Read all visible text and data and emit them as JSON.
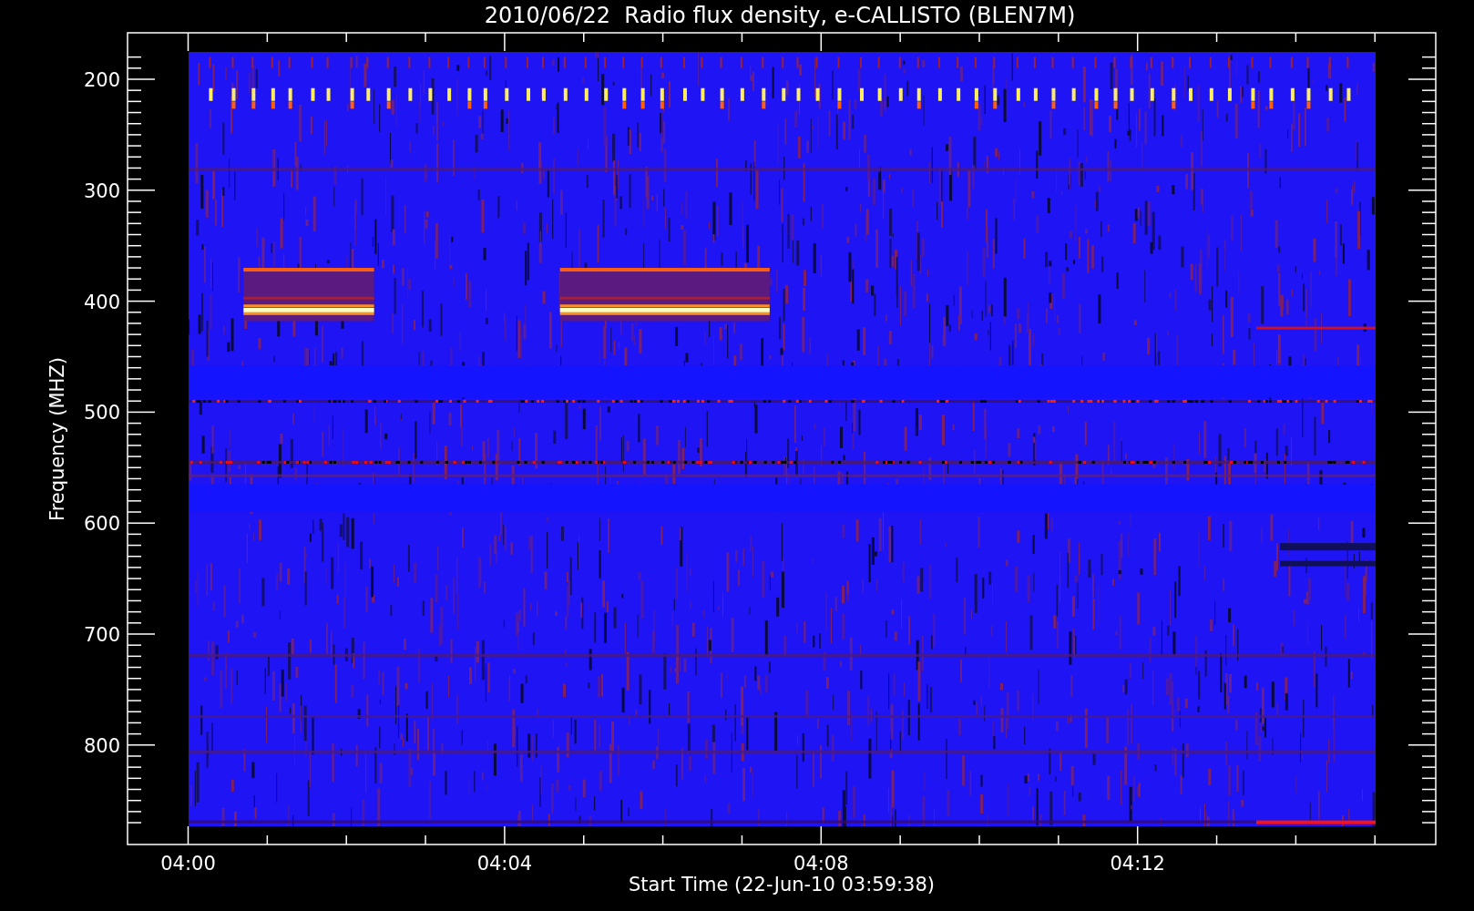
{
  "title": "2010/06/22  Radio flux density, e-CALLISTO (BLEN7M)",
  "y_axis": {
    "label": "Frequency (MHZ)",
    "ticks": [
      "200",
      "300",
      "400",
      "500",
      "600",
      "700",
      "800"
    ]
  },
  "x_axis": {
    "label": "Start Time (22-Jun-10 03:59:38)",
    "ticks": [
      "04:00",
      "04:04",
      "04:08",
      "04:12"
    ]
  }
}
